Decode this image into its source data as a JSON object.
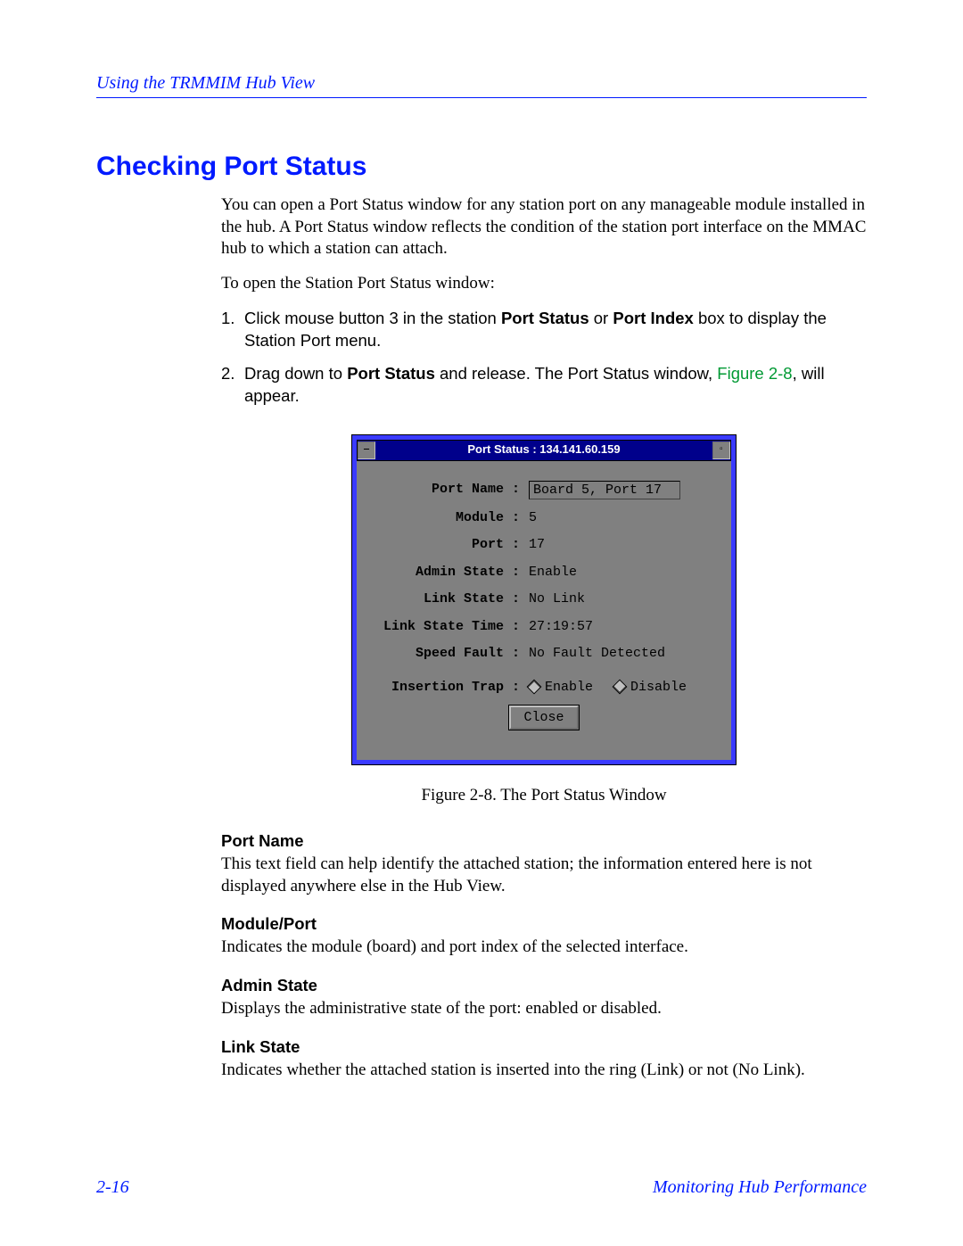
{
  "header": {
    "title": "Using the TRMMIM Hub View"
  },
  "section": {
    "title": "Checking Port Status"
  },
  "intro": {
    "p1": "You can open a Port Status window for any station port on any manageable module installed in the hub. A Port Status window reflects the condition of the station port interface on the MMAC hub to which a station can attach.",
    "p2": "To open the Station Port Status window:"
  },
  "steps": [
    {
      "num": "1.",
      "pre": "Click mouse button 3 in the station ",
      "b1": "Port Status",
      "mid": " or ",
      "b2": "Port Index",
      "post": " box to display the Station Port menu."
    },
    {
      "num": "2.",
      "pre": "Drag down to ",
      "b1": "Port Status",
      "mid": " and release. The Port Status window, ",
      "ref": "Figure 2-8",
      "post": ", will appear."
    }
  ],
  "dialog": {
    "title": "Port Status : 134.141.60.159",
    "sysmenu": "—",
    "maxbtn": "▫",
    "fields": {
      "port_name": {
        "label": "Port Name :",
        "value": "Board 5, Port 17"
      },
      "module": {
        "label": "Module :",
        "value": "5"
      },
      "port": {
        "label": "Port :",
        "value": "17"
      },
      "admin": {
        "label": "Admin State :",
        "value": "Enable"
      },
      "link": {
        "label": "Link State :",
        "value": "No Link"
      },
      "linktime": {
        "label": "Link State Time :",
        "value": "27:19:57"
      },
      "speed": {
        "label": "Speed Fault :",
        "value": "No Fault Detected"
      },
      "insert": {
        "label": "Insertion Trap :",
        "enable": "Enable",
        "disable": "Disable"
      }
    },
    "close": "Close"
  },
  "caption": "Figure 2-8.  The Port Status Window",
  "defs": [
    {
      "term": "Port Name",
      "def": "This text field can help identify the attached station; the information entered here is not displayed anywhere else in the Hub View."
    },
    {
      "term": "Module/Port",
      "def": "Indicates the module (board) and port index of the selected interface."
    },
    {
      "term": "Admin State",
      "def": "Displays the administrative state of the port: enabled or disabled."
    },
    {
      "term": "Link State",
      "def": "Indicates whether the attached station is inserted into the ring (Link) or not (No Link)."
    }
  ],
  "footer": {
    "left": "2-16",
    "right": "Monitoring Hub Performance"
  }
}
